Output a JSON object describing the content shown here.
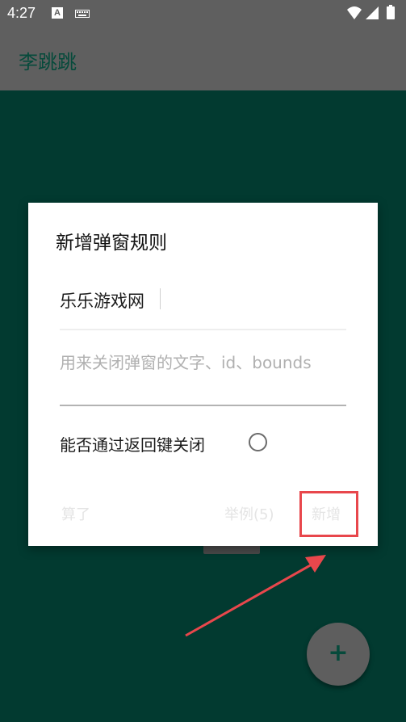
{
  "status_bar": {
    "time": "4:27",
    "icons": [
      "app-a-icon",
      "keyboard-icon",
      "wifi-icon",
      "signal-icon",
      "battery-icon"
    ]
  },
  "app_bar": {
    "title": "李跳跳"
  },
  "dialog": {
    "title": "新增弹窗规则",
    "name_field": {
      "value": "乐乐游戏网"
    },
    "text_field": {
      "placeholder": "用来关闭弹窗的文字、id、bounds"
    },
    "toggle": {
      "label": "能否通过返回键关闭",
      "checked": false
    },
    "buttons": {
      "cancel": "算了",
      "example": "举例(5)",
      "add": "新增"
    }
  },
  "fab": {
    "icon": "plus-icon",
    "label": "+"
  },
  "annotation": {
    "highlight_color": "#e8474c",
    "arrow_color": "#e8474c"
  },
  "colors": {
    "app_bar": "#5f5f5f",
    "content_bg": "#023a30",
    "accent": "#064a3b"
  }
}
